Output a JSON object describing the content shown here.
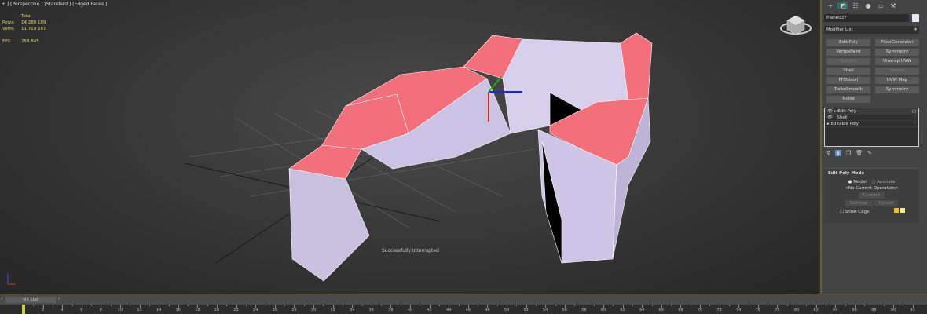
{
  "viewport": {
    "label": "+ ] [Perspective ] [Standard ] [Edged Faces ]",
    "stats": {
      "header": "Total",
      "polys_label": "Polys:",
      "polys": "14 288 189",
      "verts_label": "Verts:",
      "verts": "11 719 287",
      "fps_label": "FPS:",
      "fps": "258,845"
    },
    "status": "Successfully Interrupted"
  },
  "panel": {
    "tabs": [
      "create-icon",
      "modify-icon",
      "hierarchy-icon",
      "motion-icon",
      "display-icon",
      "utilities-icon"
    ],
    "object_name": "Plane037",
    "modifier_list": "Modifier List",
    "buttons": [
      {
        "label": "Edit Poly",
        "enabled": true
      },
      {
        "label": "FloorGenerator",
        "enabled": true
      },
      {
        "label": "VertexPaint",
        "enabled": true
      },
      {
        "label": "Symmetry",
        "enabled": true
      },
      {
        "label": "Surface",
        "enabled": false
      },
      {
        "label": "Unwrap UVW",
        "enabled": true
      },
      {
        "label": "Shell",
        "enabled": true
      },
      {
        "label": "Sweep",
        "enabled": false
      },
      {
        "label": "FFD(box)",
        "enabled": true
      },
      {
        "label": "UVW Map",
        "enabled": true
      },
      {
        "label": "TurboSmooth",
        "enabled": true
      },
      {
        "label": "Symmetry",
        "enabled": true
      },
      {
        "label": "Noise",
        "enabled": true
      }
    ],
    "stack": [
      "Edit Poly",
      "Shell",
      "Editable Poly"
    ],
    "rollout": {
      "title": "Edit Poly Mode",
      "model": "Model",
      "animate": "Animate",
      "operation": "<No Current Operation>",
      "commit": "Commit",
      "settings": "Settings",
      "cancel": "Cancel",
      "show_cage": "Show Cage"
    }
  },
  "timeline": {
    "frame": "0 / 100",
    "ticks_start": 0,
    "ticks_end": 92,
    "ticks_step": 2
  },
  "colors": {
    "accent": "#f06b78",
    "mesh": "#cfc7e6"
  }
}
